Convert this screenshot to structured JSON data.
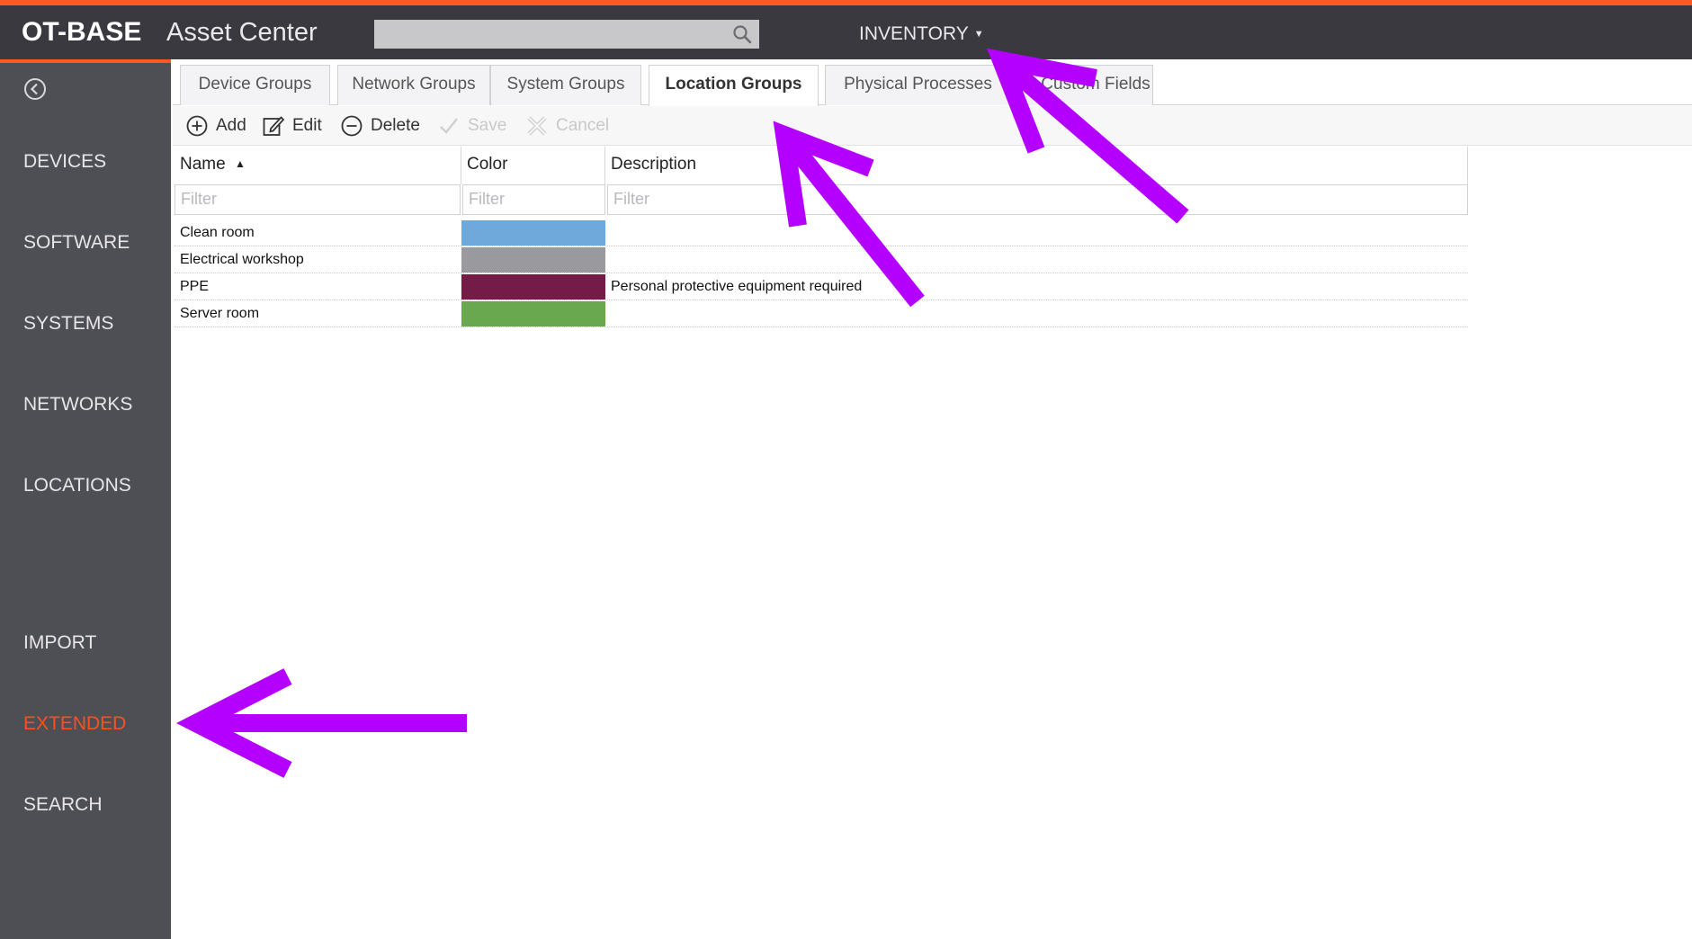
{
  "header": {
    "logo": "OT-BASE",
    "app_name": "Asset Center",
    "search_placeholder": "",
    "inventory_label": "INVENTORY"
  },
  "sidebar": {
    "items": [
      {
        "label": "DEVICES"
      },
      {
        "label": "SOFTWARE"
      },
      {
        "label": "SYSTEMS"
      },
      {
        "label": "NETWORKS"
      },
      {
        "label": "LOCATIONS"
      },
      {
        "label": "IMPORT"
      },
      {
        "label": "EXTENDED",
        "active": true
      },
      {
        "label": "SEARCH"
      }
    ]
  },
  "tabs": [
    {
      "label": "Device Groups"
    },
    {
      "label": "Network Groups"
    },
    {
      "label": "System Groups"
    },
    {
      "label": "Location Groups",
      "active": true
    },
    {
      "label": "Physical Processes"
    },
    {
      "label": "Custom Fields"
    }
  ],
  "toolbar": {
    "add": "Add",
    "edit": "Edit",
    "delete": "Delete",
    "save": "Save",
    "cancel": "Cancel"
  },
  "table": {
    "columns": [
      "Name",
      "Color",
      "Description"
    ],
    "sort_column": "Name",
    "filter_placeholder": "Filter",
    "rows": [
      {
        "name": "Clean room",
        "color": "#6fa9dc",
        "description": ""
      },
      {
        "name": "Electrical workshop",
        "color": "#9a9a9e",
        "description": ""
      },
      {
        "name": "PPE",
        "color": "#741b47",
        "description": "Personal protective equipment required"
      },
      {
        "name": "Server room",
        "color": "#6aa84f",
        "description": ""
      }
    ]
  },
  "annotations": {
    "arrow_color": "#b400ff"
  }
}
